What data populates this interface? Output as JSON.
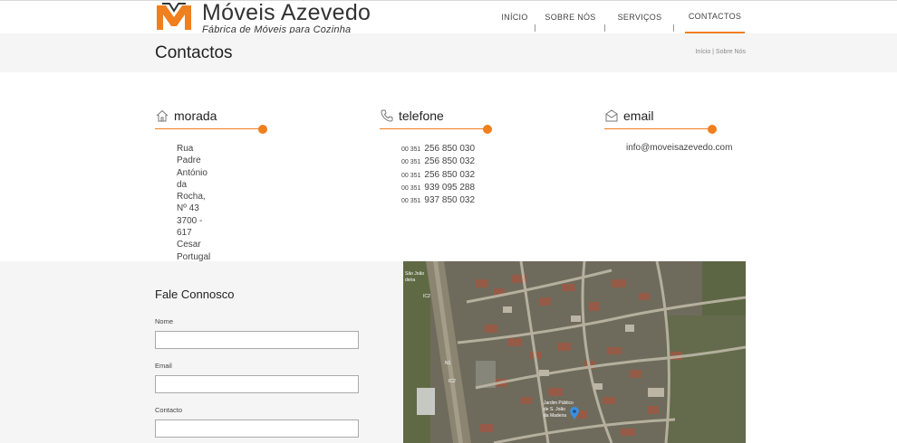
{
  "brand": {
    "name": "Móveis Azevedo",
    "tagline": "Fábrica de Móveis para Cozinha",
    "accent_color": "#f07f1e"
  },
  "nav": {
    "items": [
      {
        "label": "INÍCIO"
      },
      {
        "label": "SOBRE NÓS"
      },
      {
        "label": "SERVIÇOS"
      },
      {
        "label": "CONTACTOS",
        "active": true
      }
    ]
  },
  "page": {
    "title": "Contactos",
    "breadcrumb": "Início | Sobre Nós"
  },
  "contacts": {
    "address": {
      "icon": "home-icon",
      "title": "morada",
      "lines": [
        "Rua Padre António da",
        "Rocha, Nº 43",
        "3700 - 617 Cesar",
        "Portugal"
      ]
    },
    "phone": {
      "icon": "phone-icon",
      "title": "telefone",
      "country_code": "00 351",
      "numbers": [
        "256 850 030",
        "256 850 032",
        "256 850 032",
        "939 095 288",
        "937 850 032"
      ]
    },
    "email": {
      "icon": "envelope-icon",
      "title": "email",
      "address": "info@moveisazevedo.com"
    }
  },
  "form": {
    "title": "Fale Connosco",
    "fields": [
      {
        "label": "Nome",
        "value": ""
      },
      {
        "label": "Email",
        "value": ""
      },
      {
        "label": "Contacto",
        "value": ""
      }
    ]
  },
  "map": {
    "labels": [
      "São João da Madeira",
      "N1",
      "IC2",
      "Jardim Público de S. João da Madeira"
    ]
  }
}
